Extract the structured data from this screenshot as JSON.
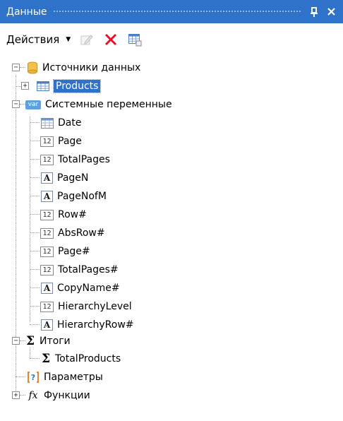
{
  "panel": {
    "title": "Данные"
  },
  "toolbar": {
    "actions_label": "Действия"
  },
  "tree": {
    "data_sources": {
      "label": "Источники данных",
      "children": [
        {
          "label": "Products"
        }
      ]
    },
    "system_variables": {
      "label": "Системные переменные",
      "icon": "var",
      "children": [
        {
          "label": "Date",
          "icon": "date-icon"
        },
        {
          "label": "Page",
          "icon": "number-icon",
          "icon_text": "12"
        },
        {
          "label": "TotalPages",
          "icon": "number-icon",
          "icon_text": "12"
        },
        {
          "label": "PageN",
          "icon": "text-icon",
          "icon_text": "A"
        },
        {
          "label": "PageNofM",
          "icon": "text-icon",
          "icon_text": "A"
        },
        {
          "label": "Row#",
          "icon": "number-icon",
          "icon_text": "12"
        },
        {
          "label": "AbsRow#",
          "icon": "number-icon",
          "icon_text": "12"
        },
        {
          "label": "Page#",
          "icon": "number-icon",
          "icon_text": "12"
        },
        {
          "label": "TotalPages#",
          "icon": "number-icon",
          "icon_text": "12"
        },
        {
          "label": "CopyName#",
          "icon": "text-icon",
          "icon_text": "A"
        },
        {
          "label": "HierarchyLevel",
          "icon": "number-icon",
          "icon_text": "12"
        },
        {
          "label": "HierarchyRow#",
          "icon": "text-icon",
          "icon_text": "A"
        }
      ]
    },
    "totals": {
      "label": "Итоги",
      "children": [
        {
          "label": "TotalProducts"
        }
      ]
    },
    "parameters": {
      "label": "Параметры",
      "icon_text": "[?]"
    },
    "functions": {
      "label": "Функции",
      "icon_text": "fx"
    }
  },
  "colors": {
    "accent": "#2f72c9",
    "delete_red": "#e81123"
  }
}
